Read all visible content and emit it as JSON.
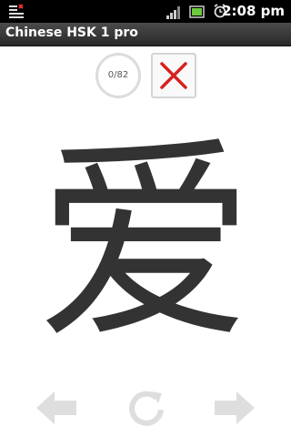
{
  "status_bar": {
    "time": "2:08 pm"
  },
  "title_bar": {
    "title": "Chinese HSK 1 pro"
  },
  "progress": {
    "text": "0/82"
  },
  "card": {
    "character": "爱"
  },
  "colors": {
    "close_x": "#d62020",
    "nav_icons": "#dedede",
    "title_bg": "#3a3a3a"
  },
  "icons": [
    "menu-icon",
    "signal-icon",
    "battery-icon",
    "alarm-icon",
    "close-icon",
    "arrow-left-icon",
    "refresh-icon",
    "arrow-right-icon"
  ]
}
